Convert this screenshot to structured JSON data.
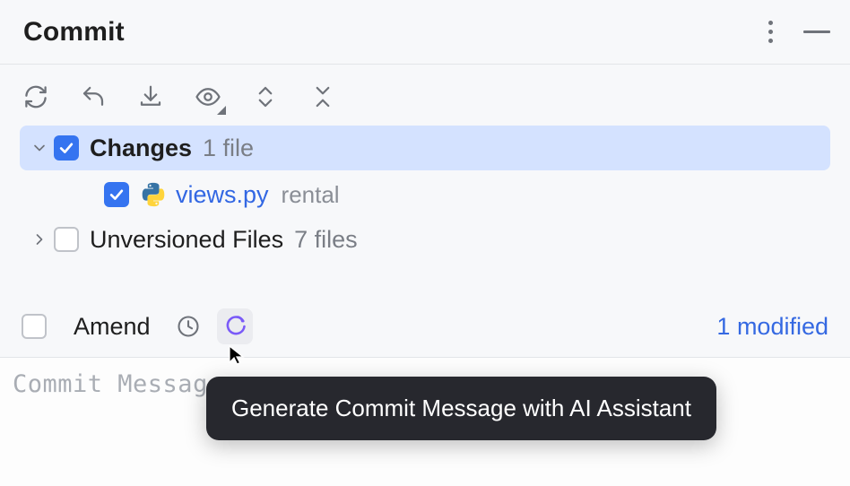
{
  "title": "Commit",
  "tree": {
    "changes": {
      "label": "Changes",
      "count": "1 file",
      "expanded": true,
      "checked": true
    },
    "file": {
      "name": "views.py",
      "path": "rental",
      "checked": true
    },
    "unversioned": {
      "label": "Unversioned Files",
      "count": "7 files",
      "expanded": false,
      "checked": false
    }
  },
  "amend": {
    "checked": false,
    "label": "Amend"
  },
  "status": {
    "modified": "1 modified"
  },
  "commit_message": {
    "placeholder": "Commit Message"
  },
  "tooltip": "Generate Commit Message with AI Assistant",
  "colors": {
    "accent": "#3574f0",
    "selection": "#d4e2ff",
    "link": "#3569e2",
    "ai": "#7a5af8"
  }
}
